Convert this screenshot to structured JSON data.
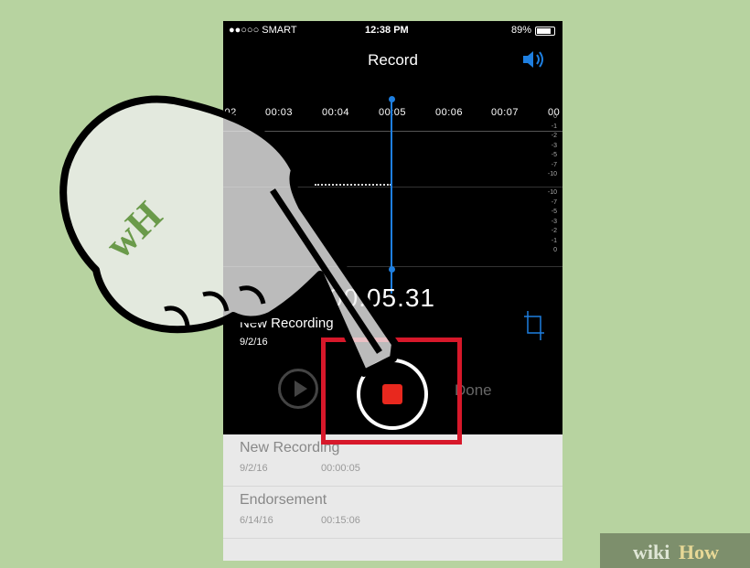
{
  "status_bar": {
    "carrier": "●●○○○ SMART",
    "time": "12:38 PM",
    "battery": "89%"
  },
  "header": {
    "title": "Record",
    "speaker_icon": "speaker-icon"
  },
  "timeline": {
    "ticks": [
      ":02",
      "00:03",
      "00:04",
      "00:05",
      "00:06",
      "00:07",
      "00"
    ],
    "scale_top": [
      "0",
      "-1",
      "-2",
      "-3",
      "-5",
      "-7",
      "-10"
    ],
    "scale_bottom": [
      "-10",
      "-7",
      "-5",
      "-3",
      "-2",
      "-1",
      "0"
    ]
  },
  "recording": {
    "timer": "00:05.31",
    "name": "New Recording",
    "date": "9/2/16"
  },
  "controls": {
    "done_label": "Done"
  },
  "list": [
    {
      "name": "New Recording",
      "date": "9/2/16",
      "duration": "00:00:05"
    },
    {
      "name": "Endorsement",
      "date": "6/14/16",
      "duration": "00:15:06"
    }
  ],
  "watermark": {
    "wiki": "wiki",
    "how": "How",
    "hand_logo": "wH"
  },
  "colors": {
    "background": "#b7d3a0",
    "accent_blue": "#1e7fe0",
    "record_red": "#e8281e",
    "highlight_red": "#d7182a"
  }
}
